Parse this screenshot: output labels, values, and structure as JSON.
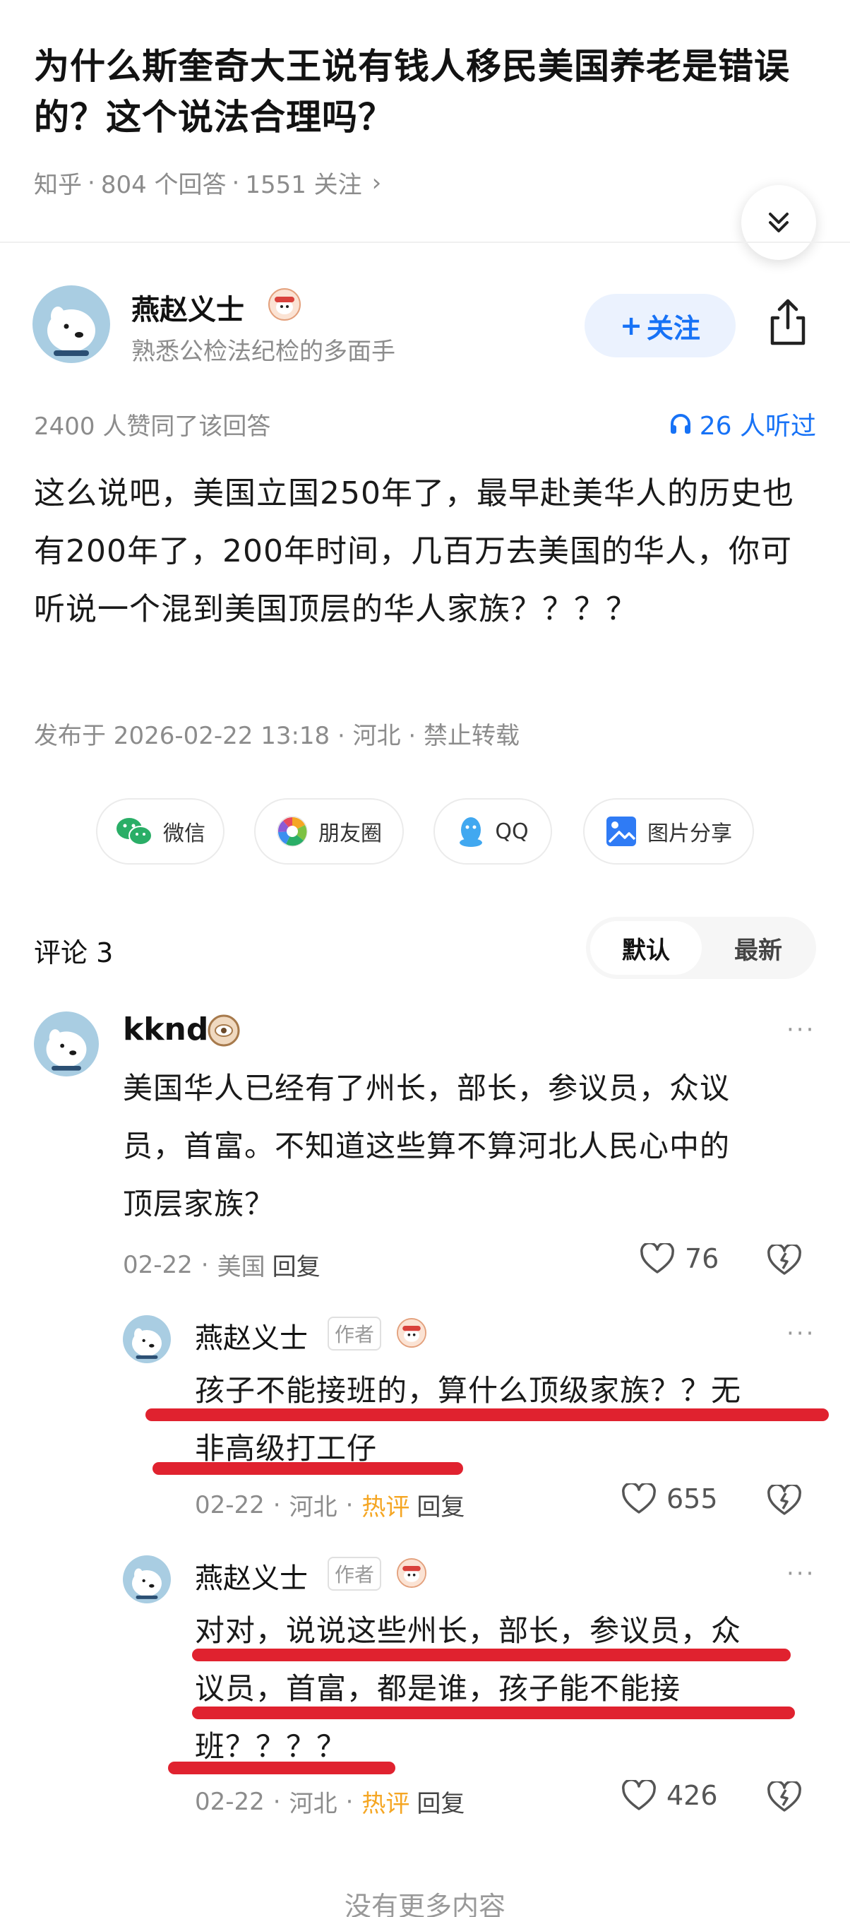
{
  "question": {
    "title": "为什么斯奎奇大王说有钱人移民美国养老是错误的？这个说法合理吗？",
    "source": "知乎",
    "answers": "804 个回答",
    "follows": "1551 关注",
    "arrow": "›"
  },
  "author": {
    "name": "燕赵义士",
    "desc": "熟悉公检法纪检的多面手",
    "follow_label": "关注",
    "follow_plus": "+"
  },
  "answer": {
    "votes": "2400 人赞同了该回答",
    "listeners": "26 人听过",
    "text": "这么说吧，美国立国250年了，最早赴美华人的历史也有200年了，200年时间，几百万去美国的华人，你可听说一个混到美国顶层的华人家族？？？？",
    "published": "发布于 2026-02-22 13:18 · 河北 · 禁止转载"
  },
  "share": {
    "wechat": "微信",
    "moments": "朋友圈",
    "qq": "QQ",
    "image": "图片分享"
  },
  "comments": {
    "title": "评论 3",
    "sort_default": "默认",
    "sort_latest": "最新",
    "items": [
      {
        "name": "kknd",
        "text_lines": [
          "美国华人已经有了州长，部长，参议员，众议",
          "员，首富。不知道这些算不算河北人民心中的",
          "顶层家族？"
        ],
        "date": "02-22",
        "location": "美国",
        "reply": "回复",
        "likes": "76"
      },
      {
        "name": "燕赵义士",
        "tag": "作者",
        "text_lines": [
          "孩子不能接班的，算什么顶级家族？？无",
          "非高级打工仔"
        ],
        "date": "02-22",
        "location": "河北",
        "hot": "热评",
        "reply": "回复",
        "likes": "655"
      },
      {
        "name": "燕赵义士",
        "tag": "作者",
        "text_lines": [
          "对对，说说这些州长，部长，参议员，众",
          "议员，首富，都是谁，孩子能不能接",
          "班？？？？"
        ],
        "date": "02-22",
        "location": "河北",
        "hot": "热评",
        "reply": "回复",
        "likes": "426"
      }
    ],
    "footer": "没有更多内容"
  },
  "colors": {
    "accent": "#1772f6",
    "hot": "#f5a623",
    "annotation": "#e0222f"
  }
}
